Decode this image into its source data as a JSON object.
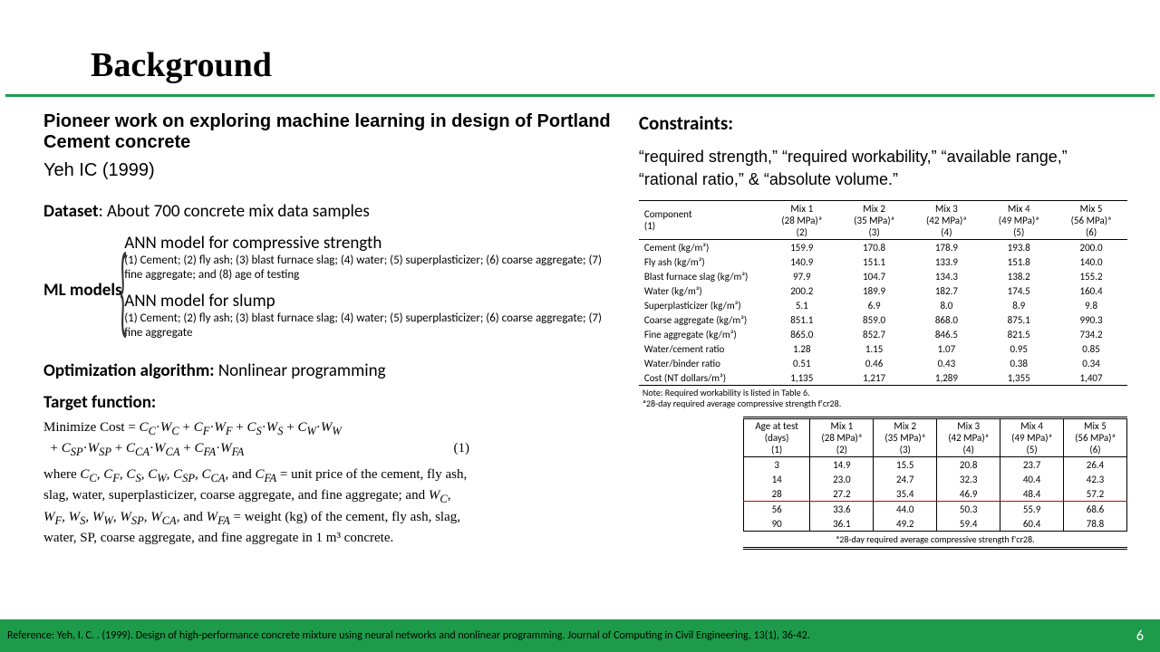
{
  "title": "Background",
  "subtitle": "Pioneer work on exploring machine learning in design of Portland Cement concrete",
  "author": "Yeh IC (1999)",
  "dataset": {
    "label": "Dataset",
    "text": ": About 700 concrete mix data samples"
  },
  "ml": {
    "label": "ML models",
    "items": [
      {
        "title": "ANN model for compressive strength",
        "sub": "(1) Cement; (2) fly ash; (3) blast furnace slag; (4) water; (5) superplasticizer; (6) coarse aggregate; (7) fine aggregate; and (8) age of testing"
      },
      {
        "title": "ANN model for slump",
        "sub": "(1) Cement; (2) fly ash; (3) blast furnace slag; (4) water; (5) superplasticizer; (6) coarse aggregate; (7) fine aggregate"
      }
    ]
  },
  "opt": {
    "label": "Optimization algorithm: ",
    "text": "Nonlinear programming"
  },
  "target": {
    "label": "Target function:"
  },
  "eq": {
    "l1": "Minimize Cost = C_C·W_C + C_F·W_F + C_S·W_S + C_W·W_W",
    "l2a": "  + C_SP·W_SP + C_CA·W_CA + C_FA·W_FA",
    "l2b": "(1)",
    "desc": "where C_C, C_F, C_S, C_W, C_SP, C_CA, and C_FA = unit price of the cement, fly ash, slag, water, superplasticizer, coarse aggregate, and fine aggregate; and W_C, W_F, W_S, W_W, W_SP, W_CA, and W_FA = weight (kg) of the cement, fly ash, slag, water, SP, coarse aggregate, and fine aggregate in 1 m³ concrete."
  },
  "constraints": {
    "title": "Constraints:",
    "body": "“required strength,” “required workability,” “available range,” “rational ratio,” & “absolute volume.”"
  },
  "table1": {
    "headers": [
      "Component\n(1)",
      "Mix 1\n(28 MPa)ª\n(2)",
      "Mix 2\n(35 MPa)ª\n(3)",
      "Mix 3\n(42 MPa)ª\n(4)",
      "Mix 4\n(49 MPa)ª\n(5)",
      "Mix 5\n(56 MPa)ª\n(6)"
    ],
    "rows": [
      [
        "Cement (kg/m³)",
        "159.9",
        "170.8",
        "178.9",
        "193.8",
        "200.0"
      ],
      [
        "Fly ash (kg/m³)",
        "140.9",
        "151.1",
        "133.9",
        "151.8",
        "140.0"
      ],
      [
        "Blast furnace slag (kg/m³)",
        "97.9",
        "104.7",
        "134.3",
        "138.2",
        "155.2"
      ],
      [
        "Water (kg/m³)",
        "200.2",
        "189.9",
        "182.7",
        "174.5",
        "160.4"
      ],
      [
        "Superplasticizer (kg/m³)",
        "5.1",
        "6.9",
        "8.0",
        "8.9",
        "9.8"
      ],
      [
        "Coarse aggregate (kg/m³)",
        "851.1",
        "859.0",
        "868.0",
        "875.1",
        "990.3"
      ],
      [
        "Fine aggregate (kg/m³)",
        "865.0",
        "852.7",
        "846.5",
        "821.5",
        "734.2"
      ],
      [
        "Water/cement ratio",
        "1.28",
        "1.15",
        "1.07",
        "0.95",
        "0.85"
      ],
      [
        "Water/binder ratio",
        "0.51",
        "0.46",
        "0.43",
        "0.38",
        "0.34"
      ],
      [
        "Cost (NT dollars/m³)",
        "1,135",
        "1,217",
        "1,289",
        "1,355",
        "1,407"
      ]
    ],
    "note1": "Note: Required workability is listed in Table 6.",
    "note2": "ª28-day required average compressive strength f'cr28."
  },
  "table2": {
    "headers": [
      "Age at test\n(days)\n(1)",
      "Mix 1\n(28 MPa)ª\n(2)",
      "Mix 2\n(35 MPa)ª\n(3)",
      "Mix 3\n(42 MPa)ª\n(4)",
      "Mix 4\n(49 MPa)ª\n(5)",
      "Mix 5\n(56 MPa)ª\n(6)"
    ],
    "rows": [
      [
        "3",
        "14.9",
        "15.5",
        "20.8",
        "23.7",
        "26.4"
      ],
      [
        "14",
        "23.0",
        "24.7",
        "32.3",
        "40.4",
        "42.3"
      ],
      [
        "28",
        "27.2",
        "35.4",
        "46.9",
        "48.4",
        "57.2"
      ],
      [
        "56",
        "33.6",
        "44.0",
        "50.3",
        "55.9",
        "68.6"
      ],
      [
        "90",
        "36.1",
        "49.2",
        "59.4",
        "60.4",
        "78.8"
      ]
    ],
    "note": "ª28-day required average compressive strength f'cr28."
  },
  "reference": "Reference: Yeh, I. C. . (1999). Design of high-performance concrete mixture using neural networks and nonlinear programming. Journal of Computing in Civil Engineering, 13(1), 36-42.",
  "page": "6"
}
